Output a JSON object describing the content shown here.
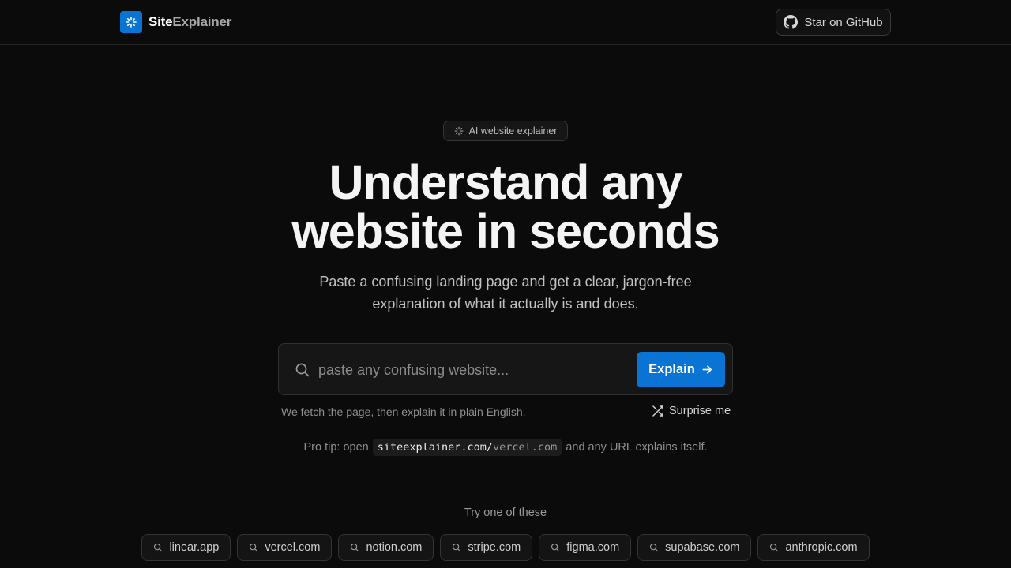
{
  "header": {
    "brand_strong": "Site",
    "brand_light": "Explainer",
    "github_label": "Star on GitHub"
  },
  "hero": {
    "badge": "AI website explainer",
    "title_line1": "Understand any",
    "title_line2": "website in seconds",
    "subtitle_line1": "Paste a confusing landing page and get a clear, jargon-free",
    "subtitle_line2": "explanation of what it actually is and does."
  },
  "search": {
    "placeholder": "paste any confusing website...",
    "button_label": "Explain",
    "helper": "We fetch the page, then explain it in plain English.",
    "surprise_label": "Surprise me"
  },
  "protip": {
    "prefix": "Pro tip: open",
    "code_base": "siteexplainer.com/",
    "code_path": "vercel.com",
    "suffix": "and any URL explains itself."
  },
  "suggestions": {
    "label": "Try one of these",
    "items": [
      "linear.app",
      "vercel.com",
      "notion.com",
      "stripe.com",
      "figma.com",
      "supabase.com",
      "anthropic.com"
    ]
  },
  "colors": {
    "background": "#0b0b0b",
    "accent": "#0a74d4"
  }
}
